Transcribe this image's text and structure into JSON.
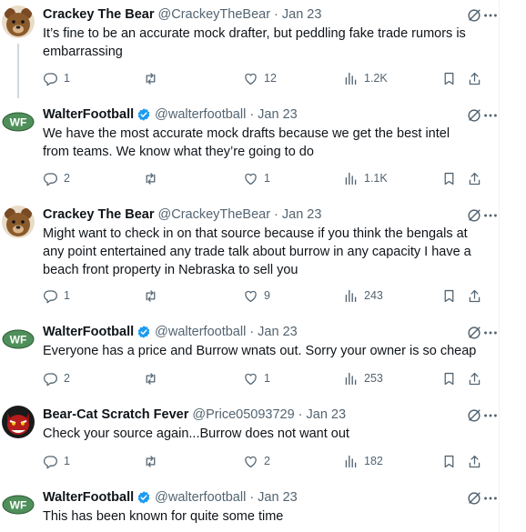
{
  "tweets": [
    {
      "name": "Crackey The Bear",
      "handle": "@CrackeyTheBear",
      "dot": "·",
      "date": "Jan 23",
      "text": "It’s fine to be an accurate mock drafter, but peddling fake trade rumors is embarrassing",
      "replies": "1",
      "retweets": "",
      "likes": "12",
      "views": "1.2K",
      "avatar": "bear",
      "verified": false
    },
    {
      "name": "WalterFootball",
      "handle": "@walterfootball",
      "dot": "·",
      "date": "Jan 23",
      "text": "We have the most accurate mock drafts because we get the best intel from teams. We know what they’re going to do",
      "replies": "2",
      "retweets": "",
      "likes": "1",
      "views": "1.1K",
      "avatar": "wf",
      "verified": true
    },
    {
      "name": "Crackey The Bear",
      "handle": "@CrackeyTheBear",
      "dot": "·",
      "date": "Jan 23",
      "text": "Might want to check in on that source because if you think the bengals at any point entertained any trade talk about burrow in any capacity I have a beach front property in Nebraska to sell you",
      "replies": "1",
      "retweets": "",
      "likes": "9",
      "views": "243",
      "avatar": "bear",
      "verified": false
    },
    {
      "name": "WalterFootball",
      "handle": "@walterfootball",
      "dot": "·",
      "date": "Jan 23",
      "text": "Everyone has a price and Burrow wnats out. Sorry your owner is so cheap",
      "replies": "2",
      "retweets": "",
      "likes": "1",
      "views": "253",
      "avatar": "wf",
      "verified": true
    },
    {
      "name": "Bear-Cat Scratch Fever",
      "handle": "@Price05093729",
      "dot": "·",
      "date": "Jan 23",
      "text": "Check your source again...Burrow does not want out",
      "replies": "1",
      "retweets": "",
      "likes": "2",
      "views": "182",
      "avatar": "cat",
      "verified": false
    },
    {
      "name": "WalterFootball",
      "handle": "@walterfootball",
      "dot": "·",
      "date": "Jan 23",
      "text": "This has been known for quite some time",
      "replies": "",
      "retweets": "",
      "likes": "",
      "views": "",
      "avatar": "wf",
      "verified": true
    }
  ],
  "colors": {
    "text": "#0f1419",
    "muted": "#536471",
    "verified": "#1d9bf0",
    "thread_line": "#cfd9de",
    "wf_green": "#4f8f5a"
  },
  "icons": [
    "grok-icon",
    "more-icon",
    "reply-icon",
    "retweet-icon",
    "like-icon",
    "views-icon",
    "bookmark-icon",
    "share-icon",
    "verified-badge-icon"
  ]
}
